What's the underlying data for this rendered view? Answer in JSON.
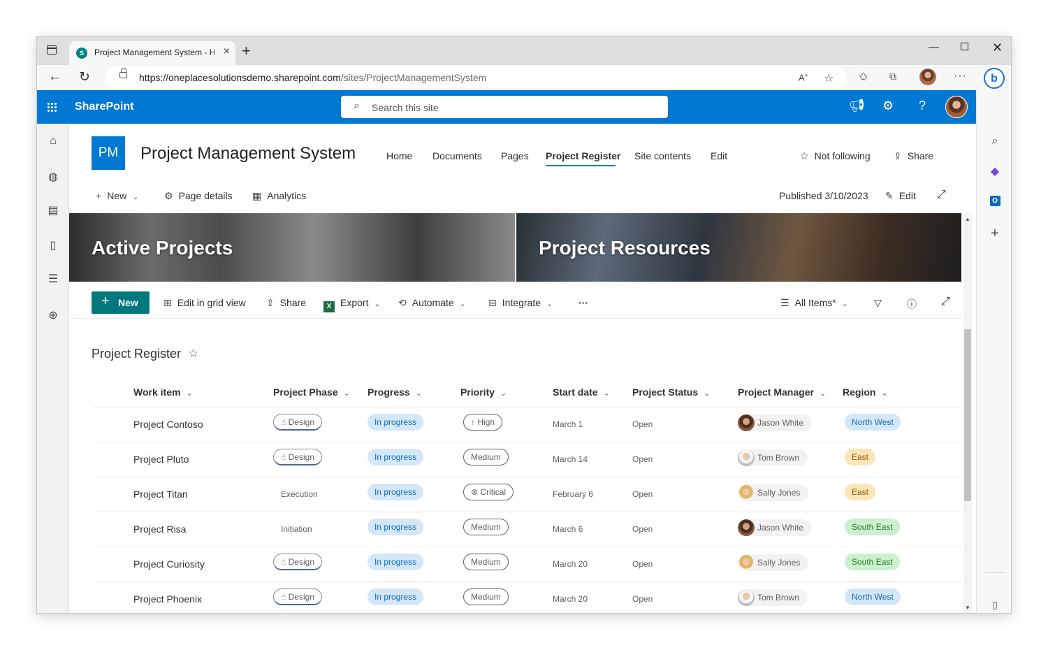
{
  "browser": {
    "tab_title": "Project Management System - H",
    "url_host": "https://oneplacesolutionsdemo.sharepoint.com",
    "url_path": "/sites/ProjectManagementSystem"
  },
  "suite": {
    "brand": "SharePoint",
    "search_placeholder": "Search this site"
  },
  "site": {
    "logo_initials": "PM",
    "title": "Project Management System",
    "nav": [
      "Home",
      "Documents",
      "Pages",
      "Project Register",
      "Site contents",
      "Edit"
    ],
    "active_nav": "Project Register",
    "follow_label": "Not following",
    "share_label": "Share"
  },
  "page_commands": {
    "new_label": "New",
    "page_details_label": "Page details",
    "analytics_label": "Analytics",
    "published": "Published 3/10/2023",
    "edit_label": "Edit"
  },
  "banners": [
    "Active Projects",
    "Project Resources"
  ],
  "list_toolbar": {
    "new_label": "New",
    "grid_label": "Edit in grid view",
    "share_label": "Share",
    "export_label": "Export",
    "automate_label": "Automate",
    "integrate_label": "Integrate",
    "more_label": "···",
    "view_label": "All Items*"
  },
  "list": {
    "title": "Project Register",
    "columns": [
      "Work item",
      "Project Phase",
      "Progress",
      "Priority",
      "Start date",
      "Project Status",
      "Project Manager",
      "Region"
    ],
    "rows": [
      {
        "work_item": "Project Contoso",
        "phase": "Design",
        "phase_icon": "hand-icon",
        "progress": "In progress",
        "priority": "High",
        "priority_icon": "arrow-up-icon",
        "start": "March 1",
        "status": "Open",
        "manager": "Jason White",
        "region": "North West"
      },
      {
        "work_item": "Project Pluto",
        "phase": "Design",
        "phase_icon": "hand-icon",
        "progress": "In progress",
        "priority": "Medium",
        "priority_icon": "",
        "start": "March 14",
        "status": "Open",
        "manager": "Tom Brown",
        "region": "East"
      },
      {
        "work_item": "Project Titan",
        "phase": "Execution",
        "phase_icon": "",
        "progress": "In progress",
        "priority": "Critical",
        "priority_icon": "cancel-circle-icon",
        "start": "February 6",
        "status": "Open",
        "manager": "Sally Jones",
        "region": "East"
      },
      {
        "work_item": "Project Risa",
        "phase": "Initiation",
        "phase_icon": "",
        "progress": "In progress",
        "priority": "Medium",
        "priority_icon": "",
        "start": "March 6",
        "status": "Open",
        "manager": "Jason White",
        "region": "South East"
      },
      {
        "work_item": "Project Curiosity",
        "phase": "Design",
        "phase_icon": "hand-icon",
        "progress": "In progress",
        "priority": "Medium",
        "priority_icon": "",
        "start": "March 20",
        "status": "Open",
        "manager": "Sally Jones",
        "region": "South East"
      },
      {
        "work_item": "Project Phoenix",
        "phase": "Design",
        "phase_icon": "hand-icon",
        "progress": "In progress",
        "priority": "Medium",
        "priority_icon": "",
        "start": "March 20",
        "status": "Open",
        "manager": "Tom Brown",
        "region": "North West"
      }
    ]
  },
  "colors": {
    "suite_bar": "#0078d4",
    "new_button": "#03787c",
    "progress_pill": "#d4e7f6",
    "region_north_west": "#d4e7f6",
    "region_east": "#fce6b8",
    "region_south_east": "#caf0cc"
  }
}
